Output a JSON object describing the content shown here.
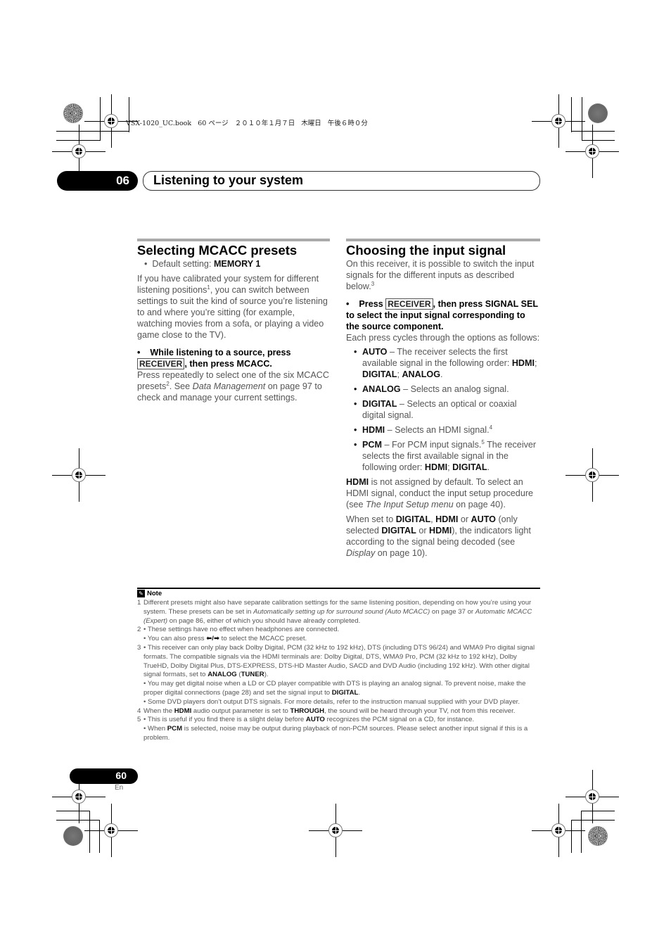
{
  "print_info": "VSX-1020_UC.book   60 ページ   ２０１０年１月７日   木曜日   午後６時０分",
  "header": {
    "chapter_number": "06",
    "chapter_title": "Listening to your system"
  },
  "left": {
    "title": "Selecting MCACC presets",
    "default_prefix": "Default setting: ",
    "default_value": "MEMORY 1",
    "intro_a": "If you have calibrated your system for different listening positions",
    "intro_sup": "1",
    "intro_b": ", you can switch between settings to suit the kind of source you’re listening to and where you’re sitting (for example, watching movies from a sofa, or playing a video game close to the TV).",
    "step_a": "While listening to a source, press",
    "step_key": "RECEIVER",
    "step_b": ", then press MCACC.",
    "body_a": "Press repeatedly to select one of the six MCACC presets",
    "body_sup": "2",
    "body_b": ". See ",
    "body_link": "Data Management",
    "body_c": " on page 97 to check and manage your current settings."
  },
  "right": {
    "title": "Choosing the input signal",
    "intro": "On this receiver, it is possible to switch the input signals for the different inputs as described below.",
    "intro_sup": "3",
    "step_a": "Press",
    "step_key": "RECEIVER",
    "step_b": ", then press SIGNAL SEL to select the input signal corresponding to the source component.",
    "cycle": "Each press cycles through the options as follows:",
    "options": [
      {
        "name": "AUTO",
        "desc": " – The receiver selects the first available signal in the following order: ",
        "order": [
          "HDMI",
          "DIGITAL",
          "ANALOG"
        ]
      },
      {
        "name": "ANALOG",
        "desc": " – Selects an analog signal."
      },
      {
        "name": "DIGITAL",
        "desc": " – Selects an optical or coaxial digital signal."
      },
      {
        "name": "HDMI",
        "desc": " – Selects an HDMI signal.",
        "sup": "4"
      },
      {
        "name": "PCM",
        "desc": " – For PCM input signals.",
        "sup": "5",
        "desc2": " The receiver selects the first available signal in the following order: ",
        "order": [
          "HDMI",
          "DIGITAL"
        ]
      }
    ],
    "hdmi_p": {
      "bold": "HDMI",
      "a": " is not assigned by default. To select an HDMI signal, conduct the input setup procedure (see ",
      "link": "The Input Setup menu",
      "b": " on page 40)."
    },
    "set_p": {
      "a": "When set to ",
      "b1": "DIGITAL",
      "c": ", ",
      "b2": "HDMI",
      "d": " or ",
      "b3": "AUTO",
      "e": " (only selected ",
      "b4": "DIGITAL",
      "f": " or ",
      "b5": "HDMI",
      "g": "), the indicators light according to the signal being decoded (see ",
      "link": "Display",
      "h": " on page 10)."
    }
  },
  "notes": {
    "heading": "Note",
    "n1": {
      "num": "1",
      "a": "Different presets might also have separate calibration settings for the same listening position, depending on how you’re using your system. These presets can be set in ",
      "i1": "Automatically setting up for surround sound (Auto MCACC)",
      "b": " on page 37 or ",
      "i2": "Automatic MCACC (Expert)",
      "c": " on page 86, either of which you should have already completed."
    },
    "n2": {
      "num": "2",
      "a": "• These settings have no effect when headphones are connected.",
      "b": "• You can also press ",
      "keys": "⬅/➡",
      "c": " to select the MCACC preset."
    },
    "n3": {
      "num": "3",
      "a": "• This receiver can only play back Dolby Digital, PCM (32 kHz to 192 kHz), DTS (including DTS 96/24) and WMA9 Pro digital signal formats. The compatible signals via the HDMI terminals are: Dolby Digital, DTS, WMA9 Pro, PCM (32 kHz to 192 kHz), Dolby TrueHD, Dolby Digital Plus, DTS-EXPRESS, DTS-HD Master Audio, SACD and DVD Audio (including 192 kHz). With other digital signal formats, set to ",
      "b1": "ANALOG",
      "b2": "TUNER",
      "c": "• You may get digital noise when a LD or CD player compatible with DTS is playing an analog signal. To prevent noise, make the proper digital connections (page 28) and set the signal input to ",
      "b3": "DIGITAL",
      "d": "• Some DVD players don’t output DTS signals. For more details, refer to the instruction manual supplied with your DVD player."
    },
    "n4": {
      "num": "4",
      "a": "When the ",
      "b1": "HDMI",
      "b": " audio output parameter is set to ",
      "b2": "THROUGH",
      "c": ", the sound will be heard through your TV, not from this receiver."
    },
    "n5": {
      "num": "5",
      "a": "• This is useful if you find there is a slight delay before ",
      "b1": "AUTO",
      "b": " recognizes the PCM signal on a CD, for instance.",
      "c": "• When ",
      "b2": "PCM",
      "d": " is selected, noise may be output during playback of non-PCM sources. Please select another input signal if this is a problem."
    }
  },
  "footer": {
    "page_number": "60",
    "language": "En"
  }
}
